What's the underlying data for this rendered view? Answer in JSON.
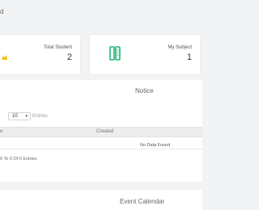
{
  "header": {
    "title_fragment": "d"
  },
  "cards": {
    "student": {
      "label": "Total Student",
      "count": "2",
      "icon": "user-icon",
      "icon_color": "#f2c400"
    },
    "subject": {
      "label": "My Subject",
      "count": "1",
      "icon": "book-icon",
      "icon_color": "#22b573"
    }
  },
  "notice": {
    "title": "Notice",
    "entries": {
      "selected": "10",
      "label": "Entries"
    },
    "table": {
      "columns": [
        "e",
        "Created"
      ],
      "empty_message": "No Data Found"
    },
    "showing": "0 To 0 Of 0 Entries"
  },
  "event_calendar": {
    "title": "Event Calendar"
  }
}
